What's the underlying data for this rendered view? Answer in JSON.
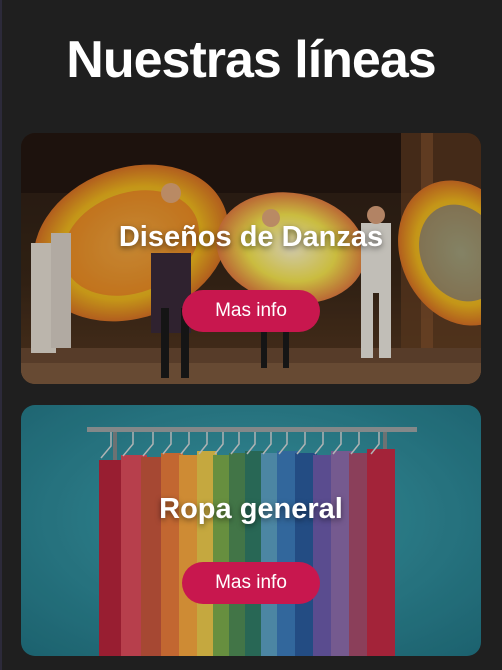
{
  "page": {
    "title": "Nuestras líneas"
  },
  "cards": [
    {
      "title": "Diseños de Danzas",
      "button_label": "Mas info",
      "image": "folk-dancers-photo"
    },
    {
      "title": "Ropa general",
      "button_label": "Mas info",
      "image": "clothing-rack-photo"
    }
  ],
  "colors": {
    "background": "#1f1f1f",
    "button": "#c8174e",
    "text": "#ffffff"
  }
}
